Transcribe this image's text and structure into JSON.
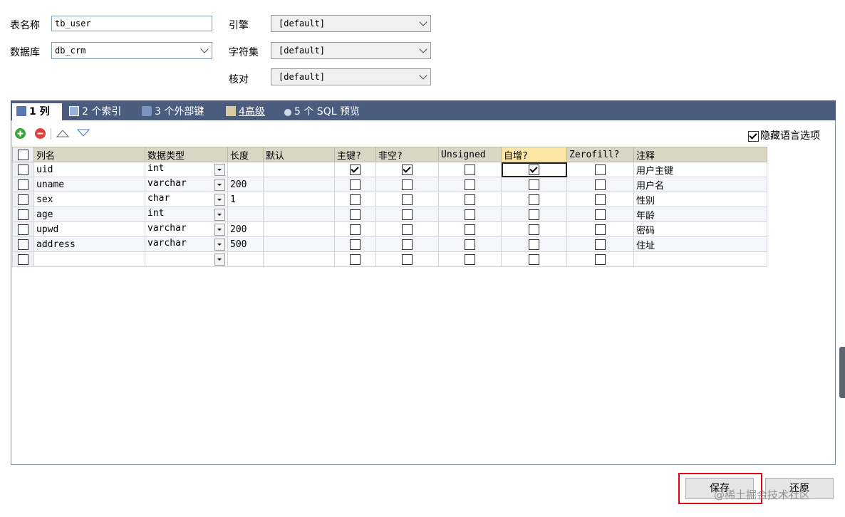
{
  "form": {
    "table_name_label": "表名称",
    "table_name_value": "tb_user",
    "database_label": "数据库",
    "database_value": "db_crm",
    "engine_label": "引擎",
    "engine_value": "[default]",
    "charset_label": "字符集",
    "charset_value": "[default]",
    "collation_label": "核对",
    "collation_value": "[default]"
  },
  "tabs": [
    {
      "label": "1 列",
      "active": true
    },
    {
      "label": "2 个索引"
    },
    {
      "label": "3 个外部键"
    },
    {
      "label": "4高级"
    },
    {
      "label": "5 个 SQL 预览"
    }
  ],
  "toolbar": {
    "add_icon": "add-circle-icon",
    "remove_icon": "remove-circle-icon",
    "up_icon": "arrow-up-icon",
    "down_icon": "arrow-down-icon",
    "hide_lang_label": "隐藏语言选项",
    "hide_lang_checked": true
  },
  "columns": [
    "列名",
    "数据类型",
    "长度",
    "默认",
    "主键?",
    "非空?",
    "Unsigned",
    "自增?",
    "Zerofill?",
    "注释"
  ],
  "rows": [
    {
      "name": "uid",
      "type": "int",
      "length": "",
      "default": "",
      "pk": true,
      "notnull": true,
      "unsigned": false,
      "auto": true,
      "zerofill": false,
      "comment": "用户主键"
    },
    {
      "name": "uname",
      "type": "varchar",
      "length": "200",
      "default": "",
      "pk": false,
      "notnull": false,
      "unsigned": false,
      "auto": false,
      "zerofill": false,
      "comment": "用户名"
    },
    {
      "name": "sex",
      "type": "char",
      "length": "1",
      "default": "",
      "pk": false,
      "notnull": false,
      "unsigned": false,
      "auto": false,
      "zerofill": false,
      "comment": "性别"
    },
    {
      "name": "age",
      "type": "int",
      "length": "",
      "default": "",
      "pk": false,
      "notnull": false,
      "unsigned": false,
      "auto": false,
      "zerofill": false,
      "comment": "年龄"
    },
    {
      "name": "upwd",
      "type": "varchar",
      "length": "200",
      "default": "",
      "pk": false,
      "notnull": false,
      "unsigned": false,
      "auto": false,
      "zerofill": false,
      "comment": "密码"
    },
    {
      "name": "address",
      "type": "varchar",
      "length": "500",
      "default": "",
      "pk": false,
      "notnull": false,
      "unsigned": false,
      "auto": false,
      "zerofill": false,
      "comment": "住址"
    },
    {
      "name": "",
      "type": "",
      "length": "",
      "default": "",
      "pk": false,
      "notnull": false,
      "unsigned": false,
      "auto": false,
      "zerofill": false,
      "comment": ""
    }
  ],
  "buttons": {
    "save_label": "保存",
    "restore_label": "还原"
  },
  "watermark": "@稀土掘金技术社区",
  "colors": {
    "tabbar": "#4a5d7e",
    "header": "#d9d6c6",
    "header_highlight": "#fde6a6",
    "highlight_box": "#e60012"
  }
}
